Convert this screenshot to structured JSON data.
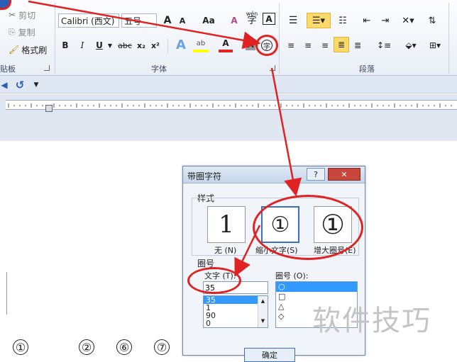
{
  "clipboard": {
    "cut": "剪切",
    "copy": "复制",
    "format_painter": "格式刷",
    "group_label": "贴板"
  },
  "font": {
    "font_name": "Calibri (西文)",
    "font_size": "五号",
    "group_label": "字体",
    "aa_label": "Aa",
    "wen_char": "字",
    "wen_top": "wén",
    "bold": "B",
    "italic": "I",
    "underline": "U",
    "strike": "abc",
    "sub": "x₂",
    "sup": "x²",
    "grow": "A",
    "shrink": "A"
  },
  "paragraph": {
    "group_label": "段落"
  },
  "dialog": {
    "title": "带圈字符",
    "help": "?",
    "close": "✕",
    "style_section": "样式",
    "style_options": [
      {
        "label": "无 (N)",
        "glyph": "1"
      },
      {
        "label": "缩小文字(S)",
        "glyph": "①"
      },
      {
        "label": "增大圈号(E)",
        "glyph": "①"
      }
    ],
    "circle_section": "圈号",
    "text_label": "文字 (T):",
    "text_value": "35",
    "text_list": [
      "35",
      "1",
      "90",
      "0"
    ],
    "enclosure_label": "圈号 (O):",
    "enclosure_list": [
      "○",
      "□",
      "△",
      "◇"
    ],
    "ok": "确定"
  },
  "document": {
    "circled": [
      "①",
      "②",
      "⑥",
      "⑦"
    ]
  },
  "watermark": "软件技巧",
  "colors": {
    "accent": "#e02222",
    "selection": "#3399ff"
  }
}
